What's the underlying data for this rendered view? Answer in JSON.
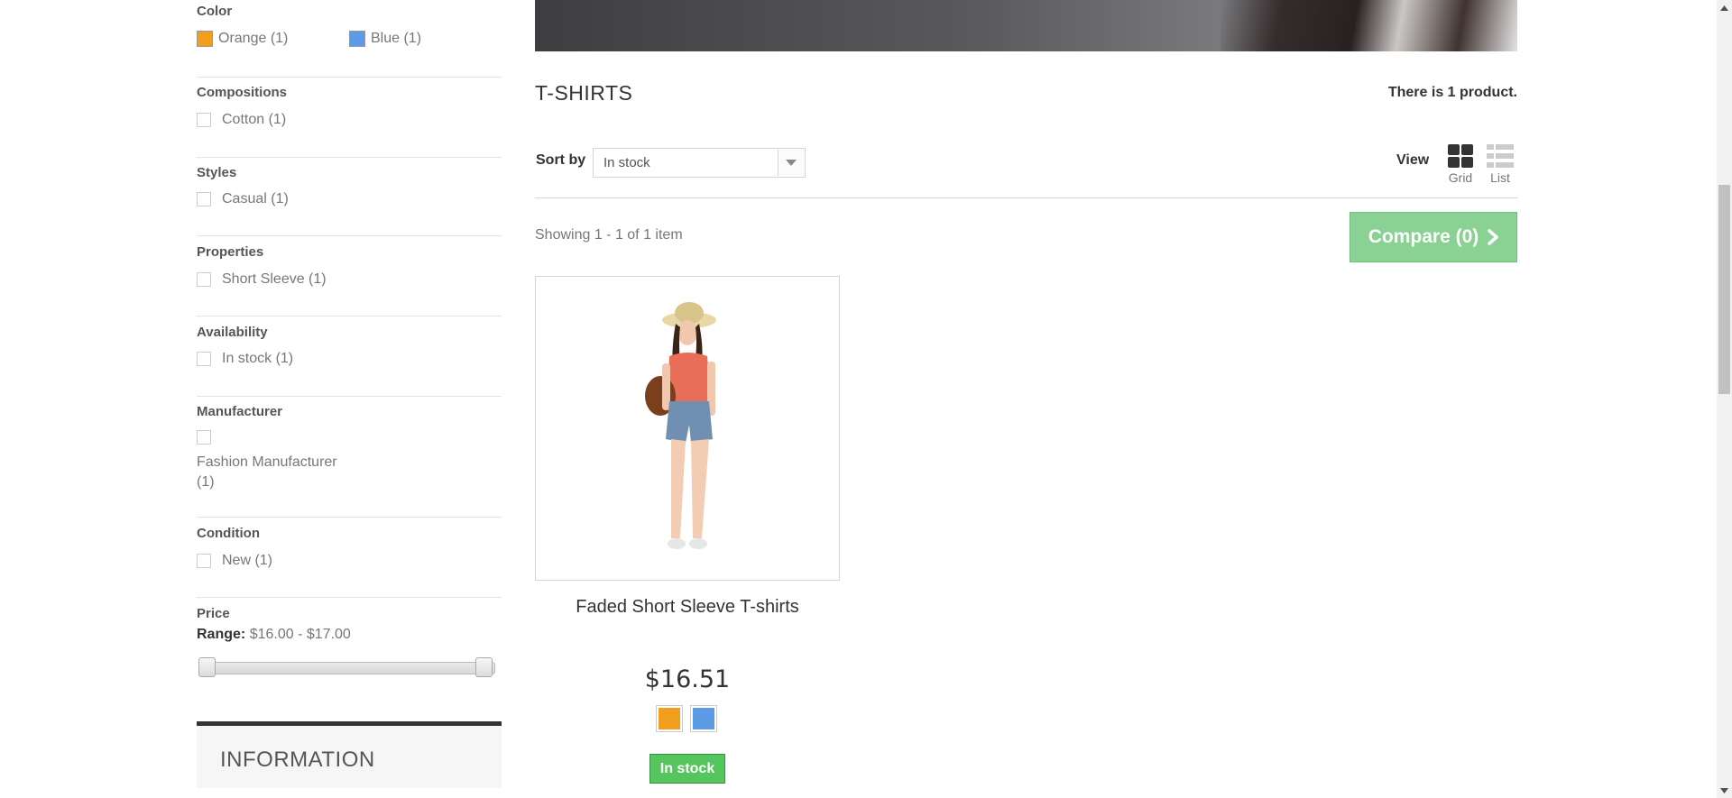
{
  "filters": {
    "color": {
      "title": "Color",
      "options": [
        {
          "label": "Orange (1)",
          "color": "#f39d1d"
        },
        {
          "label": "Blue (1)",
          "color": "#5e9be6"
        }
      ]
    },
    "compositions": {
      "title": "Compositions",
      "options": [
        "Cotton (1)"
      ]
    },
    "styles": {
      "title": "Styles",
      "options": [
        "Casual (1)"
      ]
    },
    "properties": {
      "title": "Properties",
      "options": [
        "Short Sleeve (1)"
      ]
    },
    "availability": {
      "title": "Availability",
      "options": [
        "In stock (1)"
      ]
    },
    "manufacturer": {
      "title": "Manufacturer",
      "options": [
        "Fashion Manufacturer (1)"
      ]
    },
    "condition": {
      "title": "Condition",
      "options": [
        "New (1)"
      ]
    },
    "price": {
      "title": "Price",
      "range_label": "Range:",
      "range_value": "$16.00 - $17.00"
    }
  },
  "info_block": {
    "title": "INFORMATION"
  },
  "category": {
    "title": "T-SHIRTS",
    "product_count": "There is 1 product.",
    "sort_label": "Sort by",
    "sort_value": "In stock",
    "view_label": "View",
    "view_grid": "Grid",
    "view_list": "List",
    "showing": "Showing 1 - 1 of 1 item",
    "compare_label": "Compare (0)"
  },
  "product": {
    "name": "Faded Short Sleeve T-shirts",
    "price": "$16.51",
    "colors": [
      "#f39d1d",
      "#5e9be6"
    ],
    "stock_label": "In stock"
  },
  "colors": {
    "accent_green": "#55c65e",
    "compare_green": "#89d293"
  }
}
